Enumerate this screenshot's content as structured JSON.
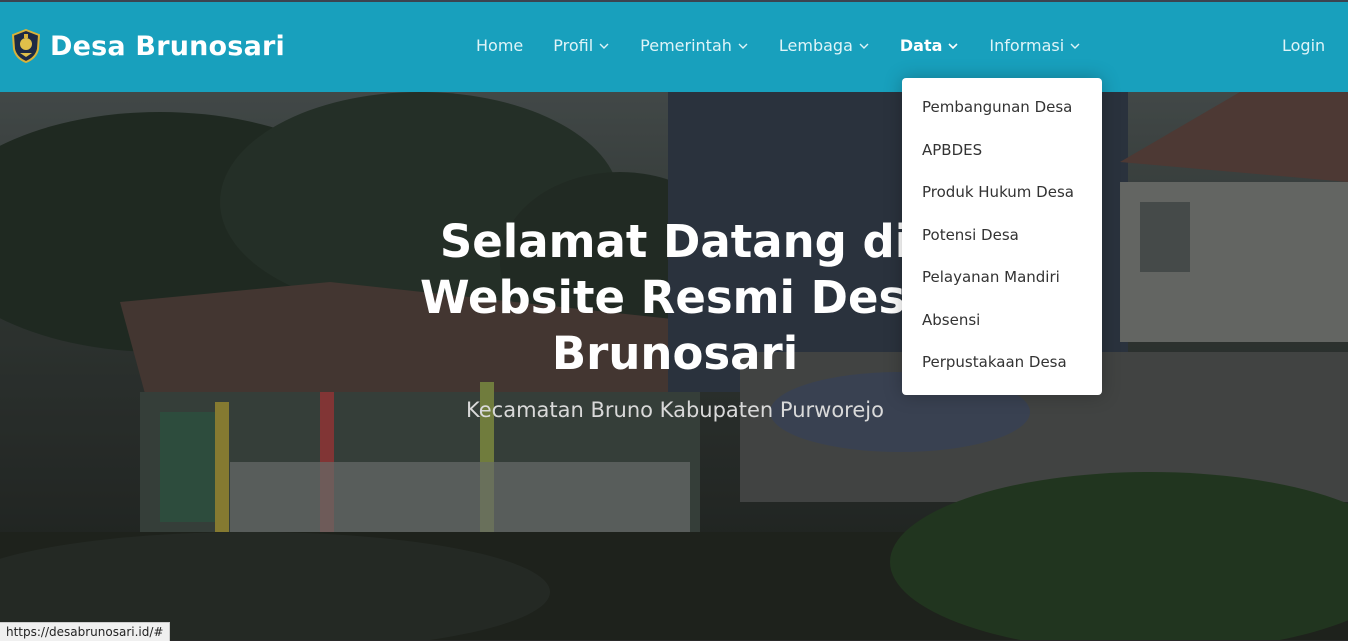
{
  "brand": {
    "name": "Desa Brunosari",
    "logo_icon": "village-emblem-icon"
  },
  "nav": {
    "items": [
      {
        "label": "Home",
        "has_dropdown": false,
        "active": false
      },
      {
        "label": "Profil",
        "has_dropdown": true,
        "active": false
      },
      {
        "label": "Pemerintah",
        "has_dropdown": true,
        "active": false
      },
      {
        "label": "Lembaga",
        "has_dropdown": true,
        "active": false
      },
      {
        "label": "Data",
        "has_dropdown": true,
        "active": true
      },
      {
        "label": "Informasi",
        "has_dropdown": true,
        "active": false
      }
    ],
    "login_label": "Login"
  },
  "dropdown": {
    "items": [
      "Pembangunan Desa",
      "APBDES",
      "Produk Hukum Desa",
      "Potensi Desa",
      "Pelayanan Mandiri",
      "Absensi",
      "Perpustakaan Desa"
    ]
  },
  "hero": {
    "title_lines": [
      "Selamat Datang di",
      "Website Resmi Desa",
      "Brunosari"
    ],
    "subtitle": "Kecamatan Bruno Kabupaten Purworejo"
  },
  "status_url": "https://desabrunosari.id/#",
  "colors": {
    "navbar": "#18a0bd",
    "dropdown_bg": "#ffffff",
    "text_dark": "#333333"
  }
}
